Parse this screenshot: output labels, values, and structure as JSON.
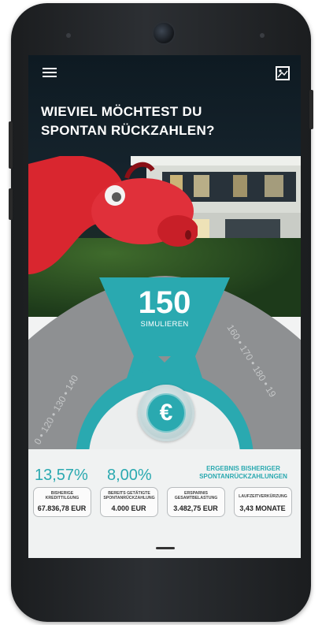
{
  "header": {
    "menu_icon": "hamburger-menu-icon",
    "image_icon": "image-icon",
    "headline_line1": "WIEVIEL MÖCHTEST DU",
    "headline_line2": "SPONTAN RÜCKZAHLEN?"
  },
  "wheel": {
    "selected_value": "150",
    "action_label": "SIMULIEREN",
    "left_ticks": "0 • 120 • 130 • 140",
    "right_ticks": "160 • 170 • 180 • 19",
    "euro_symbol": "€",
    "colors": {
      "accent": "#2aa9b0",
      "dial": "#8e9092"
    }
  },
  "stats": {
    "pct_1": "13,57%",
    "pct_2": "8,00%",
    "result_label_line1": "ERGEBNIS BISHERIGER",
    "result_label_line2": "SPONTANRÜCKZAHLUNGEN",
    "cards": [
      {
        "label_line1": "BISHERIGE",
        "label_line2": "KREDITTILGUNG",
        "value": "67.836,78 EUR"
      },
      {
        "label_line1": "BEREITS GETÄTIGTE",
        "label_line2": "SPONTANRÜCKZAHLUNG",
        "value": "4.000 EUR"
      },
      {
        "label_line1": "ERSPARNIS",
        "label_line2": "GESAMTBELASTUNG",
        "value": "3.482,75 EUR"
      },
      {
        "label_line1": "LAUFZEITVERKÜRZUNG",
        "label_line2": "",
        "value": "3,43 MONATE"
      }
    ]
  }
}
